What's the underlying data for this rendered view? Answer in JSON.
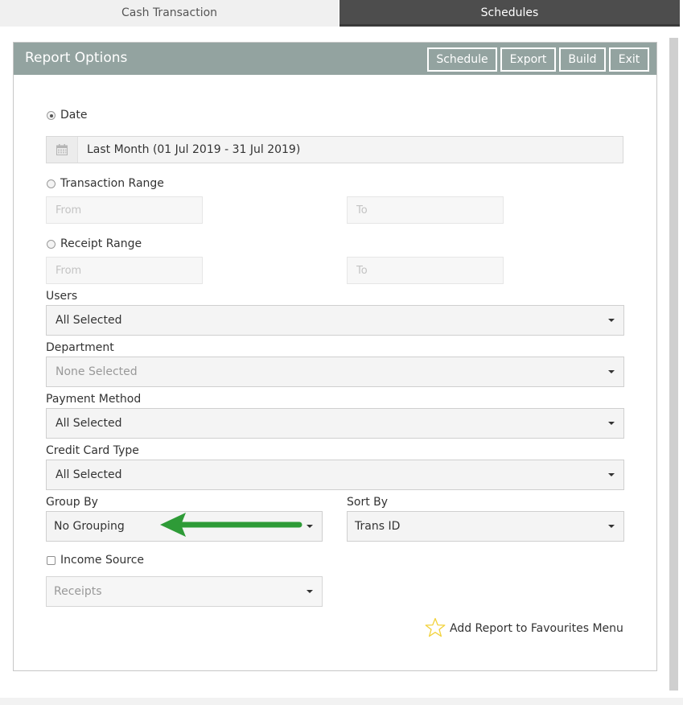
{
  "tabs": [
    {
      "label": "Cash Transaction",
      "active": true
    },
    {
      "label": "Schedules",
      "active": false
    }
  ],
  "panel": {
    "title": "Report Options",
    "buttons": {
      "schedule": "Schedule",
      "export": "Export",
      "build": "Build",
      "exit": "Exit"
    }
  },
  "date": {
    "label": "Date",
    "selected": true,
    "value": "Last Month (01 Jul 2019 - 31 Jul 2019)",
    "icon": "calendar-icon"
  },
  "transaction_range": {
    "label": "Transaction Range",
    "selected": false,
    "from_placeholder": "From",
    "to_placeholder": "To"
  },
  "receipt_range": {
    "label": "Receipt Range",
    "selected": false,
    "from_placeholder": "From",
    "to_placeholder": "To"
  },
  "users": {
    "label": "Users",
    "value": "All Selected"
  },
  "department": {
    "label": "Department",
    "value": "None Selected"
  },
  "payment_method": {
    "label": "Payment Method",
    "value": "All Selected"
  },
  "credit_card_type": {
    "label": "Credit Card Type",
    "value": "All Selected"
  },
  "group_by": {
    "label": "Group By",
    "value": "No Grouping"
  },
  "sort_by": {
    "label": "Sort By",
    "value": "Trans ID"
  },
  "income_source": {
    "label": "Income Source",
    "checked": false,
    "value": "Receipts"
  },
  "favourites": {
    "label": "Add Report to Favourites Menu",
    "icon": "star-icon"
  },
  "colors": {
    "header": "#93a3a0",
    "arrow": "#2e9b37",
    "star": "#f2d23c",
    "tab_dark": "#4d4d4d"
  },
  "annotation": {
    "icon": "green-arrow-icon"
  }
}
